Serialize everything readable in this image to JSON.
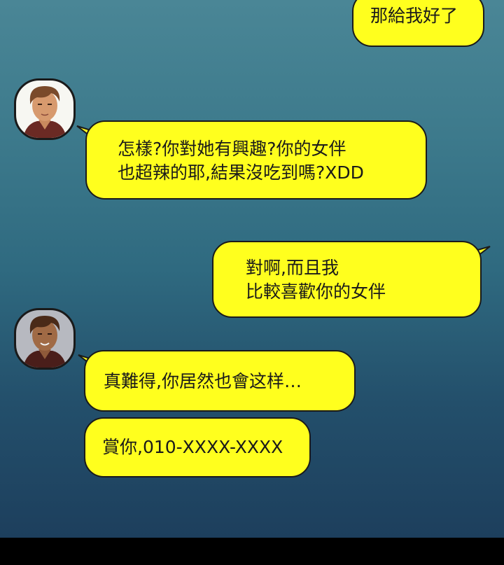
{
  "messages": [
    {
      "side": "right",
      "lines": [
        "那給我好了"
      ]
    },
    {
      "side": "left",
      "lines": [
        "怎樣?你對她有興趣?你的女伴",
        "也超辣的耶,結果沒吃到嗎?XDD"
      ]
    },
    {
      "side": "right",
      "lines": [
        "對啊,而且我",
        "比較喜歡你的女伴"
      ]
    },
    {
      "side": "left",
      "lines": [
        "真難得,你居然也會这样…"
      ]
    },
    {
      "side": "left",
      "lines": [
        "賞你,010-XXXX-XXXX"
      ]
    }
  ],
  "colors": {
    "bubble": "#ffff1e",
    "outline": "#1a1a1a",
    "bg_top": "#4a8696",
    "bg_bottom": "#1d3f5d"
  },
  "icons": [
    "avatar-male-character"
  ]
}
